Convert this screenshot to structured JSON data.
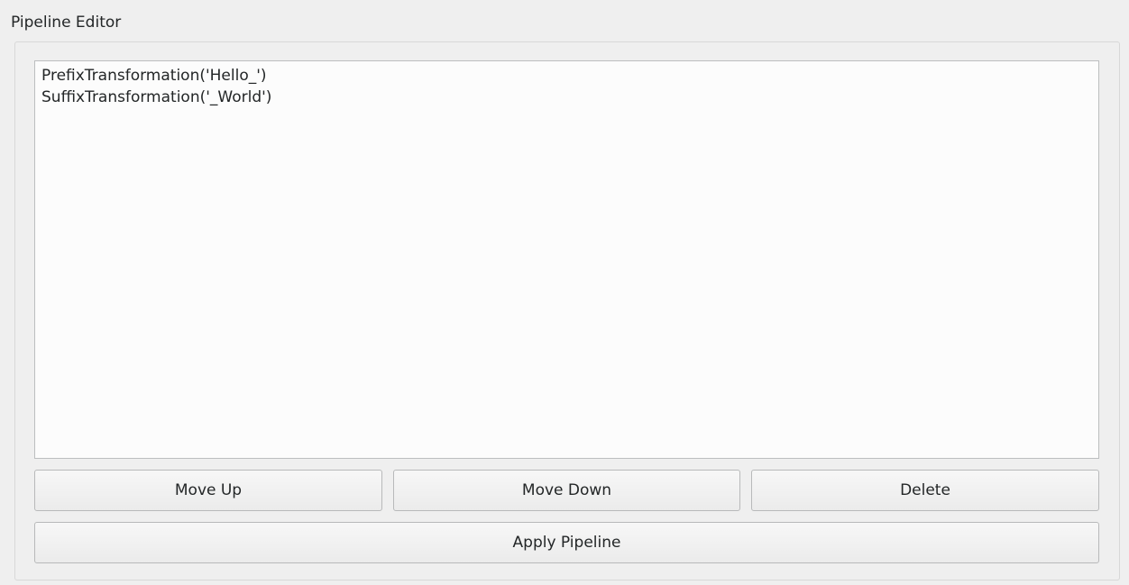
{
  "group": {
    "title": "Pipeline Editor"
  },
  "pipeline": {
    "items": [
      "PrefixTransformation('Hello_')",
      "SuffixTransformation('_World')"
    ]
  },
  "buttons": {
    "move_up": "Move Up",
    "move_down": "Move Down",
    "delete": "Delete",
    "apply": "Apply Pipeline"
  }
}
